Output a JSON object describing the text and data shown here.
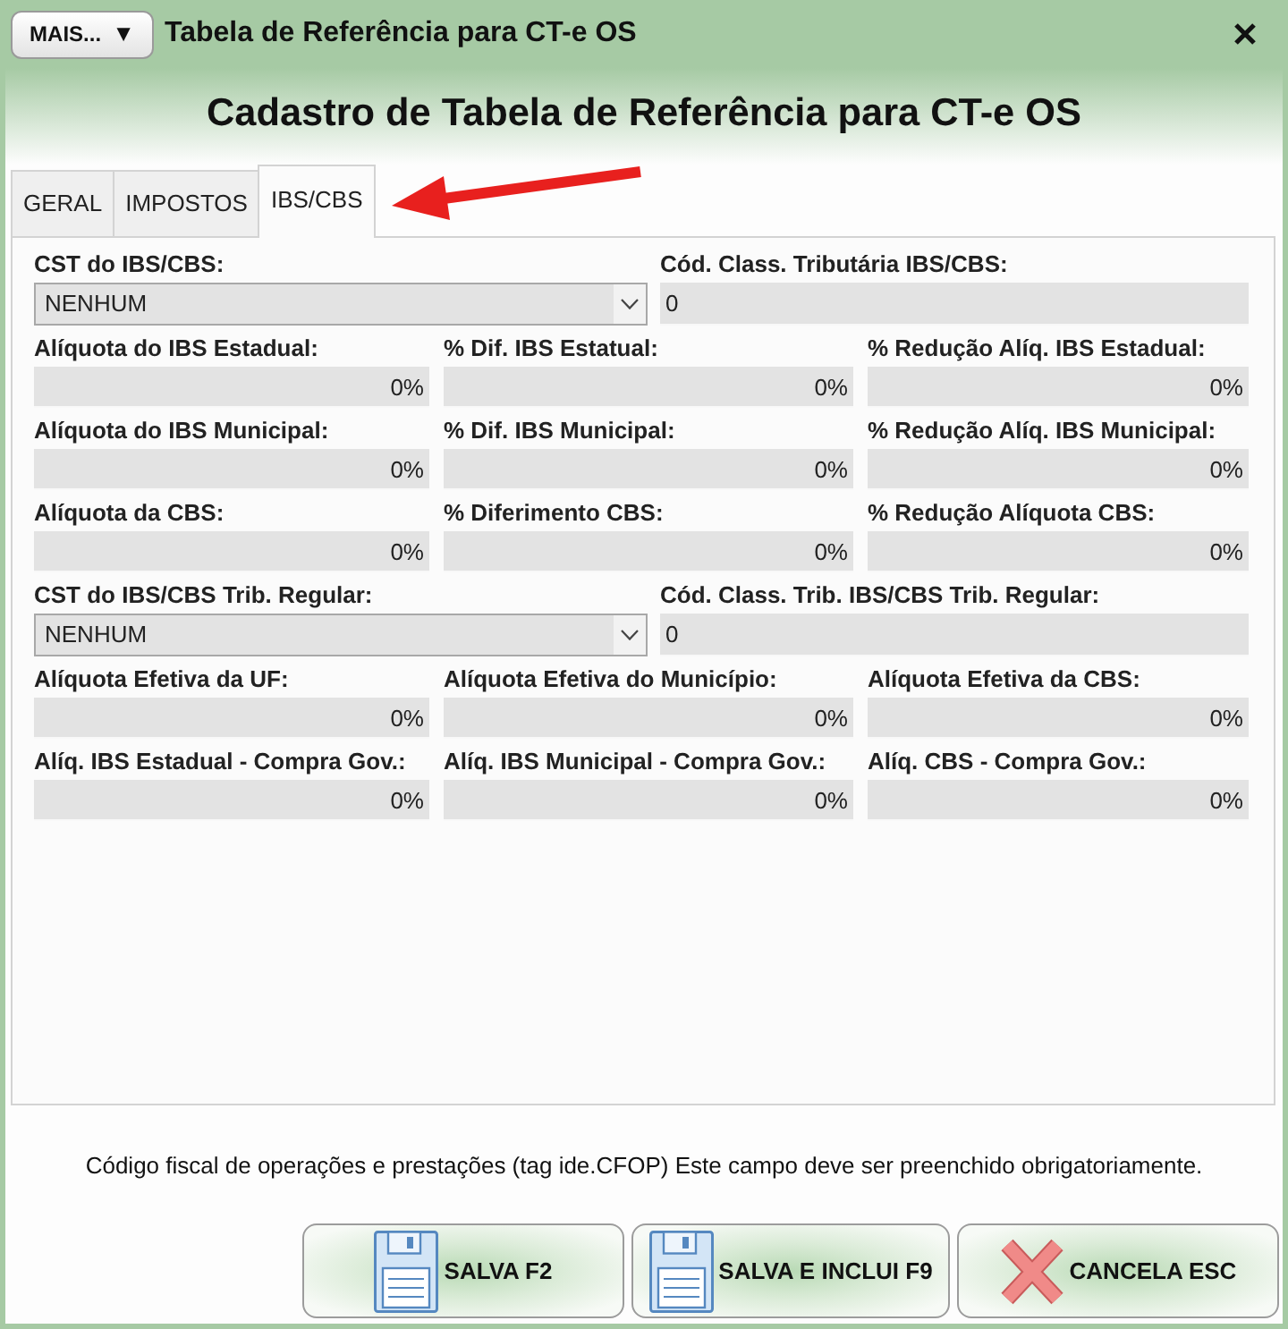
{
  "window": {
    "title": "Tabela de Referência para CT-e OS",
    "menu_button": {
      "label": "MAIS...",
      "caret": "▼"
    }
  },
  "header": {
    "title": "Cadastro de Tabela de Referência para CT-e OS"
  },
  "tabs": [
    {
      "label": "GERAL",
      "selected": false
    },
    {
      "label": "IMPOSTOS",
      "selected": false
    },
    {
      "label": "IBS/CBS",
      "selected": true
    }
  ],
  "form": {
    "rows": [
      {
        "fields": [
          {
            "label": "CST do IBS/CBS:",
            "input": {
              "kind": "select",
              "value": "NENHUM"
            }
          },
          {
            "label": "Cód. Class. Tributária IBS/CBS:",
            "input": {
              "kind": "text",
              "value": "0"
            }
          }
        ]
      },
      {
        "fields": [
          {
            "label": "Alíquota do IBS Estadual:",
            "input": {
              "kind": "percent",
              "value": "0%"
            }
          },
          {
            "label": "% Dif. IBS Estatual:",
            "input": {
              "kind": "percent",
              "value": "0%"
            }
          },
          {
            "label": "% Redução Alíq. IBS Estadual:",
            "input": {
              "kind": "percent",
              "value": "0%"
            }
          }
        ]
      },
      {
        "fields": [
          {
            "label": "Alíquota do IBS Municipal:",
            "input": {
              "kind": "percent",
              "value": "0%"
            }
          },
          {
            "label": "% Dif. IBS Municipal:",
            "input": {
              "kind": "percent",
              "value": "0%"
            }
          },
          {
            "label": "% Redução Alíq. IBS Municipal:",
            "input": {
              "kind": "percent",
              "value": "0%"
            }
          }
        ]
      },
      {
        "fields": [
          {
            "label": "Alíquota da CBS:",
            "input": {
              "kind": "percent",
              "value": "0%"
            }
          },
          {
            "label": "% Diferimento CBS:",
            "input": {
              "kind": "percent",
              "value": "0%"
            }
          },
          {
            "label": "% Redução Alíquota CBS:",
            "input": {
              "kind": "percent",
              "value": "0%"
            }
          }
        ]
      },
      {
        "fields": [
          {
            "label": "CST do IBS/CBS Trib. Regular:",
            "input": {
              "kind": "select",
              "value": "NENHUM"
            }
          },
          {
            "label": "Cód. Class. Trib. IBS/CBS Trib. Regular:",
            "input": {
              "kind": "text",
              "value": "0"
            }
          }
        ]
      },
      {
        "fields": [
          {
            "label": "Alíquota Efetiva da UF:",
            "input": {
              "kind": "percent",
              "value": "0%"
            }
          },
          {
            "label": "Alíquota Efetiva do Município:",
            "input": {
              "kind": "percent",
              "value": "0%"
            }
          },
          {
            "label": "Alíquota Efetiva da CBS:",
            "input": {
              "kind": "percent",
              "value": "0%"
            }
          }
        ]
      },
      {
        "fields": [
          {
            "label": "Alíq. IBS Estadual - Compra Gov.:",
            "input": {
              "kind": "percent",
              "value": "0%"
            }
          },
          {
            "label": "Alíq. IBS Municipal - Compra Gov.:",
            "input": {
              "kind": "percent",
              "value": "0%"
            }
          },
          {
            "label": "Alíq. CBS - Compra Gov.:",
            "input": {
              "kind": "percent",
              "value": "0%"
            }
          }
        ]
      }
    ]
  },
  "hint": "Código fiscal de operações e prestações (tag ide.CFOP) Este campo deve ser preenchido obrigatoriamente.",
  "buttons": [
    {
      "kind": "save",
      "label": "SALVA F2"
    },
    {
      "kind": "save",
      "label": "SALVA E INCLUI F9"
    },
    {
      "kind": "cancel",
      "label": "CANCELA ESC"
    }
  ]
}
